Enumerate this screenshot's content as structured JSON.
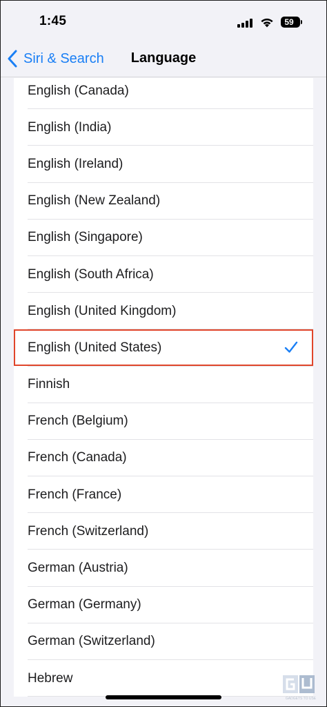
{
  "status_bar": {
    "time": "1:45",
    "battery": "59",
    "icons": [
      "signal-icon",
      "wifi-icon",
      "battery-icon"
    ]
  },
  "nav": {
    "back_label": "Siri & Search",
    "title": "Language",
    "back_icon": "chevron-left-icon"
  },
  "languages": [
    {
      "label": "English (Canada)",
      "selected": false
    },
    {
      "label": "English (India)",
      "selected": false
    },
    {
      "label": "English (Ireland)",
      "selected": false
    },
    {
      "label": "English (New Zealand)",
      "selected": false
    },
    {
      "label": "English (Singapore)",
      "selected": false
    },
    {
      "label": "English (South Africa)",
      "selected": false
    },
    {
      "label": "English (United Kingdom)",
      "selected": false
    },
    {
      "label": "English (United States)",
      "selected": true
    },
    {
      "label": "Finnish",
      "selected": false
    },
    {
      "label": "French (Belgium)",
      "selected": false
    },
    {
      "label": "French (Canada)",
      "selected": false
    },
    {
      "label": "French (France)",
      "selected": false
    },
    {
      "label": "French (Switzerland)",
      "selected": false
    },
    {
      "label": "German (Austria)",
      "selected": false
    },
    {
      "label": "German (Germany)",
      "selected": false
    },
    {
      "label": "German (Switzerland)",
      "selected": false
    },
    {
      "label": "Hebrew",
      "selected": false
    }
  ],
  "colors": {
    "accent": "#1a7ff5",
    "highlight": "#e0452a",
    "background": "#f2f2f7"
  },
  "watermark": {
    "text": "GADGETS TO USE"
  }
}
